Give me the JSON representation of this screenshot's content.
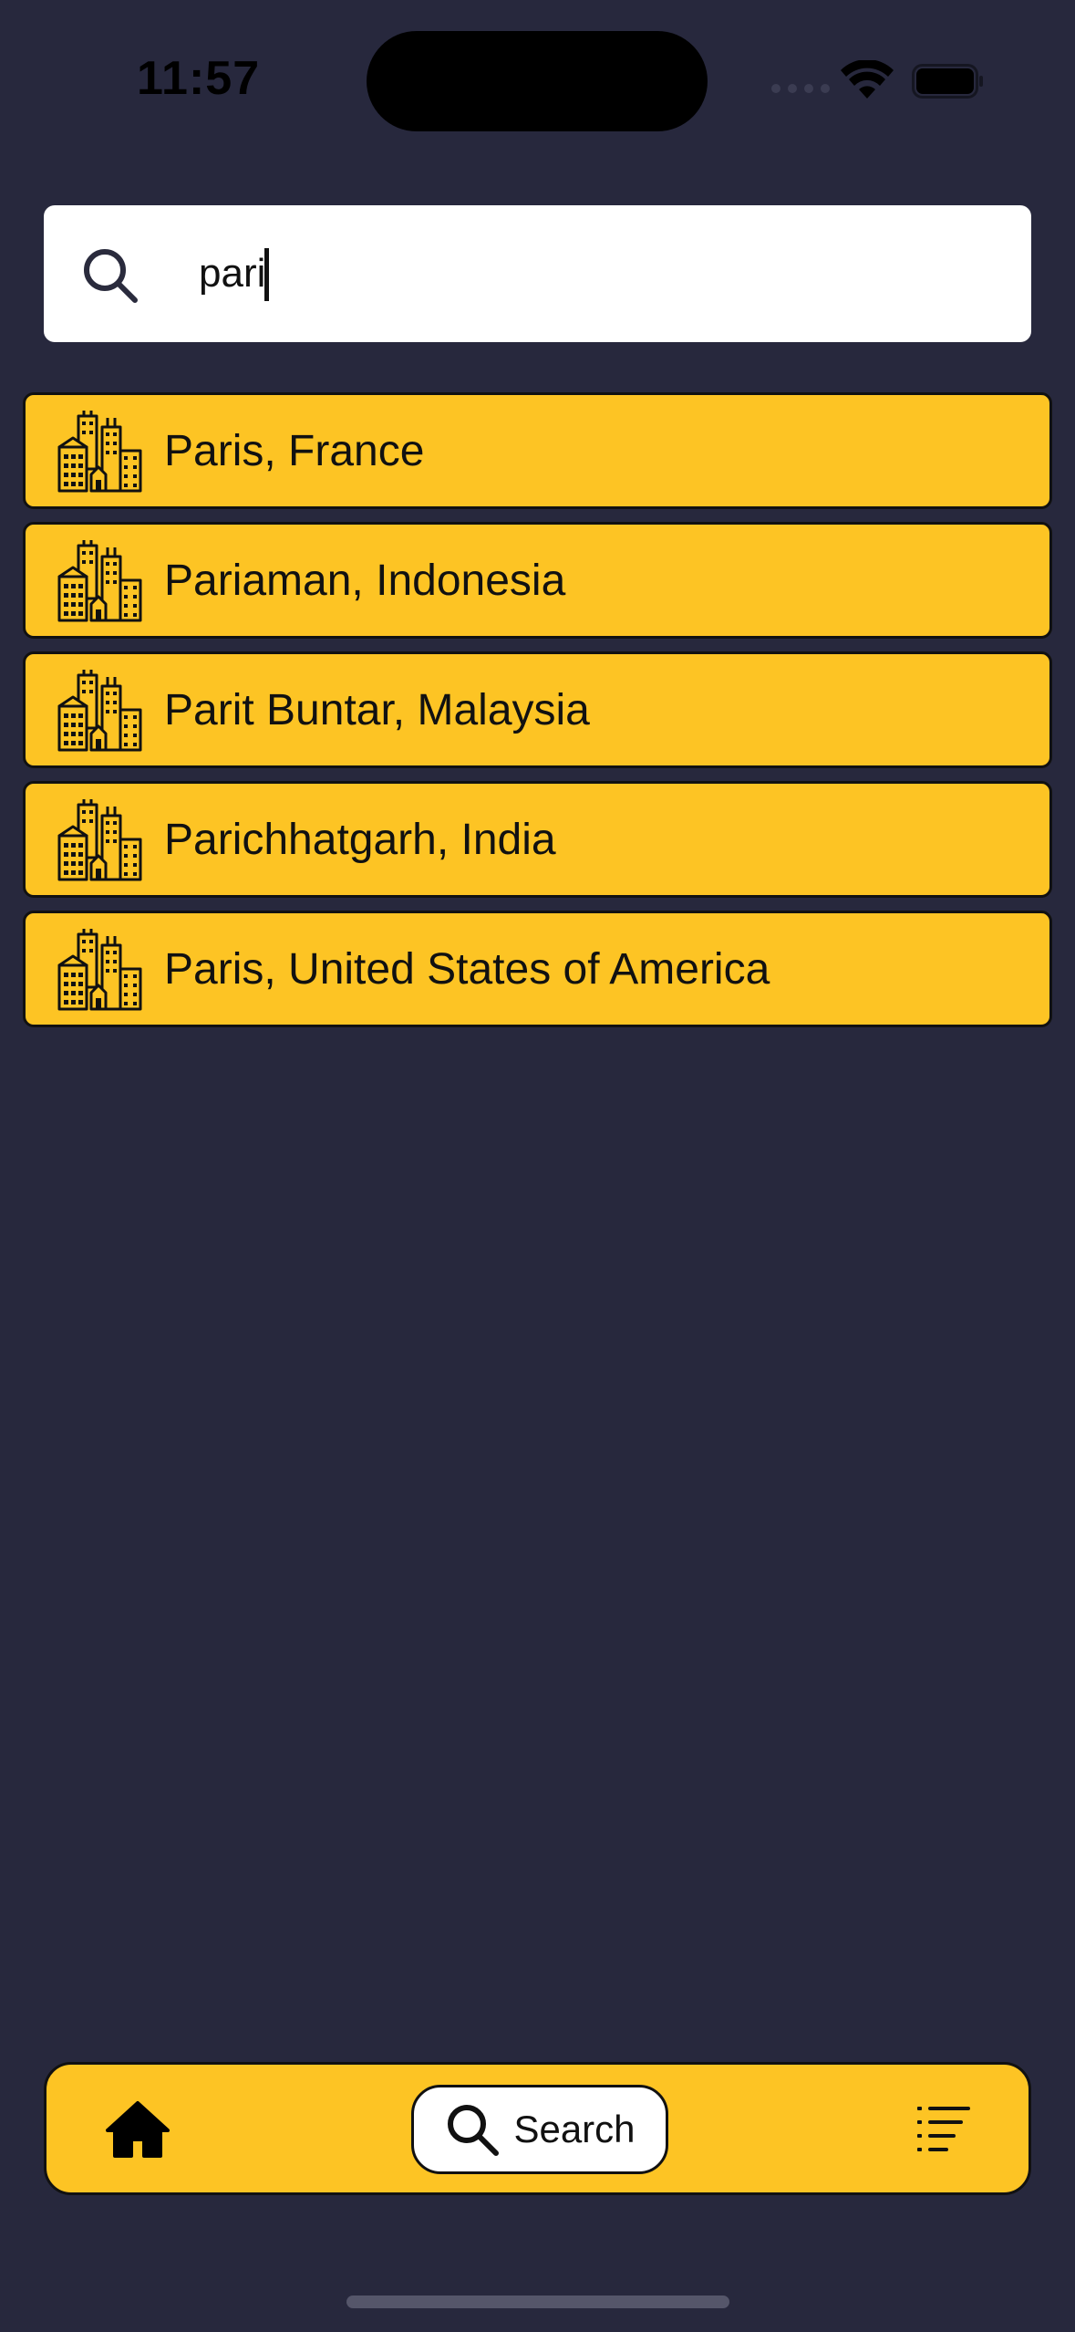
{
  "status_bar": {
    "time": "11:57"
  },
  "search": {
    "value": "pari",
    "placeholder": ""
  },
  "results": [
    {
      "label": "Paris, France",
      "icon": "city-buildings-icon"
    },
    {
      "label": "Pariaman, Indonesia",
      "icon": "city-buildings-icon"
    },
    {
      "label": "Parit Buntar, Malaysia",
      "icon": "city-buildings-icon"
    },
    {
      "label": "Parichhatgarh, India",
      "icon": "city-buildings-icon"
    },
    {
      "label": "Paris, United States of America",
      "icon": "city-buildings-icon"
    }
  ],
  "tabbar": {
    "home_icon": "home-icon",
    "search_label": "Search",
    "list_icon": "list-icon"
  },
  "colors": {
    "background": "#27283d",
    "accent": "#fdc424",
    "surface": "#ffffff",
    "text": "#111111"
  }
}
